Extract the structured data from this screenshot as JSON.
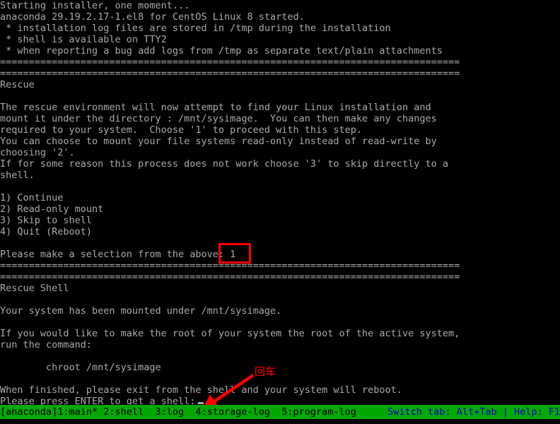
{
  "terminal": {
    "background_color": "#000000",
    "text_color": "#aaaaaa",
    "lines": [
      "Starting installer, one moment...",
      "anaconda 29.19.2.17-1.el8 for CentOS Linux 8 started.",
      " * installation log files are stored in /tmp during the installation",
      " * shell is available on TTY2",
      " * when reporting a bug add logs from /tmp as separate text/plain attachments",
      "================================================================================",
      "================================================================================",
      "Rescue",
      "",
      "The rescue environment will now attempt to find your Linux installation and",
      "mount it under the directory : /mnt/sysimage.  You can then make any changes",
      "required to your system.  Choose '1' to proceed with this step.",
      "You can choose to mount your file systems read-only instead of read-write by",
      "choosing '2'.",
      "If for some reason this process does not work choose '3' to skip directly to a",
      "shell.",
      "",
      "1) Continue",
      "2) Read-only mount",
      "3) Skip to shell",
      "4) Quit (Reboot)",
      "",
      "Please make a selection from the above: 1",
      "================================================================================",
      "================================================================================",
      "Rescue Shell",
      "",
      "Your system has been mounted under /mnt/sysimage.",
      "",
      "If you would like to make the root of your system the root of the active system,",
      "run the command:",
      "",
      "        chroot /mnt/sysimage",
      "",
      "When finished, please exit from the shell and your system will reboot.",
      "Please press ENTER to get a shell: "
    ]
  },
  "menu": {
    "prompt": "Please make a selection from the above:",
    "selected_value": "1",
    "options": [
      {
        "key": "1",
        "label": "Continue"
      },
      {
        "key": "2",
        "label": "Read-only mount"
      },
      {
        "key": "3",
        "label": "Skip to shell"
      },
      {
        "key": "4",
        "label": "Quit (Reboot)"
      }
    ]
  },
  "annotations": {
    "selection_box_color": "#ff0000",
    "arrow_color": "#ff0000",
    "enter_label": "回车"
  },
  "status_bar": {
    "background_color": "#00a800",
    "tabs_text_color": "#000000",
    "hints_text_color": "#0000c0",
    "tabs": "[anaconda]1:main* 2:shell  3:log  4:storage-log  5:program-log",
    "hints": "Switch tab: Alt+Tab | Help: F1"
  }
}
